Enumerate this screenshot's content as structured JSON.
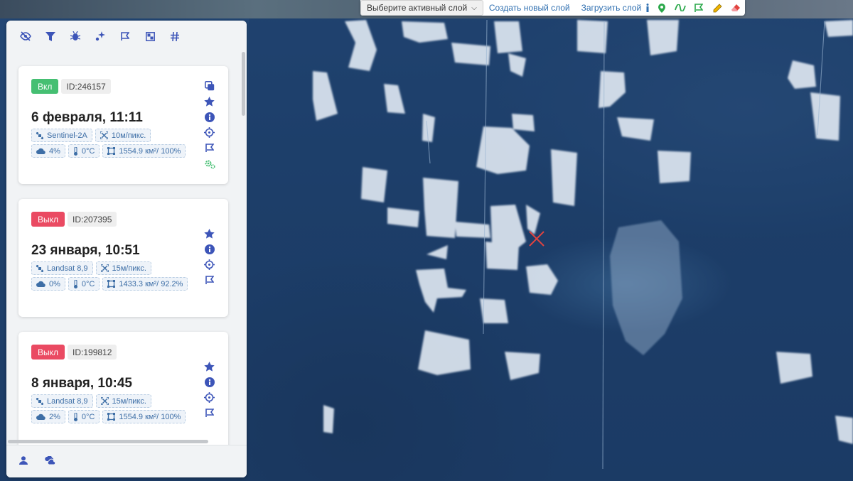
{
  "toolbar": {
    "layer_select": "Выберите активный слой",
    "create_layer": "Создать новый слой",
    "upload_layer": "Загрузить слой",
    "icons": [
      "info-icon",
      "pin-icon",
      "line-icon",
      "polygon-flag-icon",
      "pencil-icon",
      "eraser-icon"
    ]
  },
  "sidebar": {
    "header_icons": [
      "eye-off-icon",
      "filter-icon",
      "bug-icon",
      "sparkle-icon",
      "flag-icon",
      "grid-icon",
      "hash-icon"
    ],
    "footer_icons": [
      "user-icon",
      "clouds-icon"
    ],
    "cards": [
      {
        "status": "Вкл",
        "status_on": true,
        "id": "ID:246157",
        "title": "6 февраля, 11:11",
        "satellite": "Sentinel-2A",
        "resolution": "10м/пикс.",
        "clouds": "4%",
        "temperature": "0°C",
        "area": "1554.9 км²/ 100%"
      },
      {
        "status": "Выкл",
        "status_on": false,
        "id": "ID:207395",
        "title": "23 января, 10:51",
        "satellite": "Landsat 8,9",
        "resolution": "15м/пикс.",
        "clouds": "0%",
        "temperature": "0°C",
        "area": "1433.3 км²/ 92.2%"
      },
      {
        "status": "Выкл",
        "status_on": false,
        "id": "ID:199812",
        "title": "8 января, 10:45",
        "satellite": "Landsat 8,9",
        "resolution": "15м/пикс.",
        "clouds": "2%",
        "temperature": "0°C",
        "area": "1554.9 км²/ 100%"
      }
    ]
  },
  "colors": {
    "accent": "#3d55b8",
    "badge_on": "#45bf72",
    "badge_off": "#ea4a62",
    "map_marker": "#e2433f"
  }
}
